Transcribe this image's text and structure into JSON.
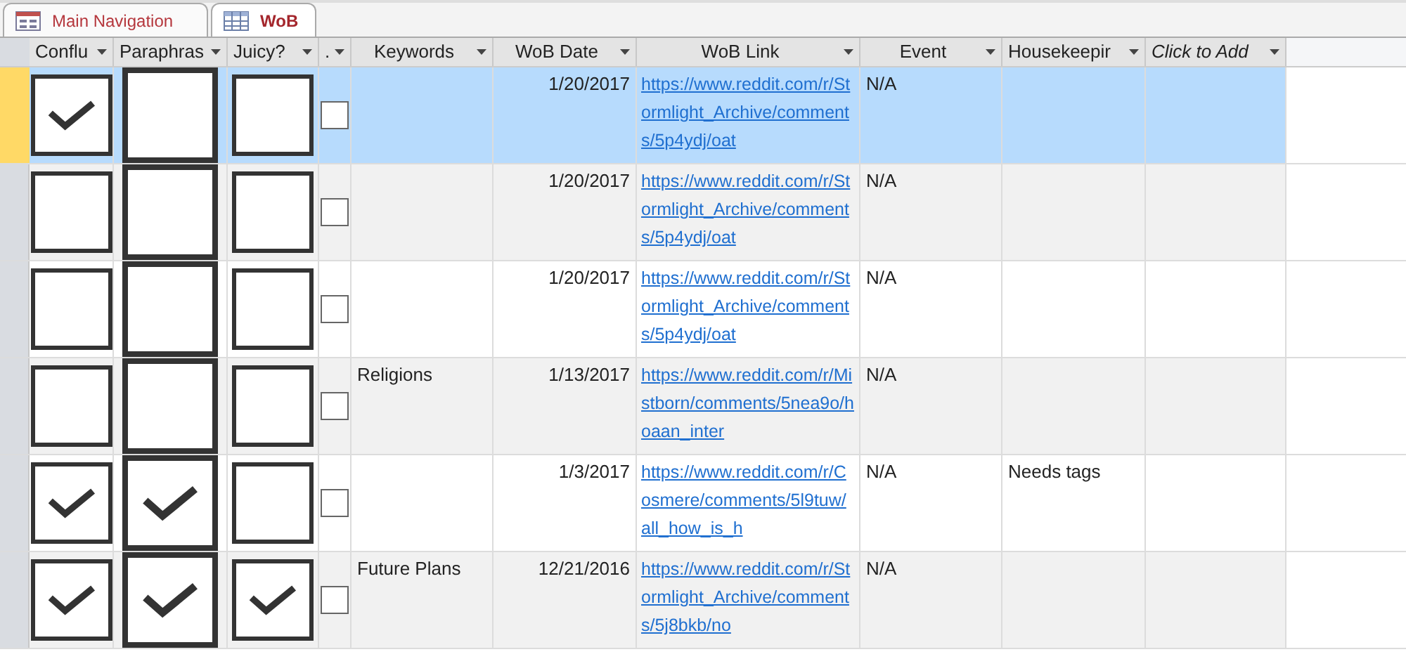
{
  "tabs": [
    {
      "label": "Main Navigation",
      "kind": "form",
      "selected": false
    },
    {
      "label": "WoB",
      "kind": "table",
      "selected": true
    }
  ],
  "table": {
    "columns": [
      {
        "label": "Conflu",
        "italic": false
      },
      {
        "label": "Paraphras",
        "italic": false
      },
      {
        "label": "Juicy?",
        "italic": false
      },
      {
        "label": ".",
        "italic": false
      },
      {
        "label": "Keywords",
        "italic": false
      },
      {
        "label": "WoB Date",
        "italic": false
      },
      {
        "label": "WoB Link",
        "italic": false
      },
      {
        "label": "Event",
        "italic": false
      },
      {
        "label": "Housekeepir",
        "italic": false
      },
      {
        "label": "Click to Add",
        "italic": true
      }
    ],
    "rows": [
      {
        "selected": true,
        "conflu": true,
        "paraphrase": false,
        "juicy": false,
        "column_4": false,
        "keywords": "",
        "date": "1/20/2017",
        "link": "https://www.reddit.com/r/Stormlight_Archive/comments/5p4ydj/oat",
        "event": "N/A",
        "housekeeping": ""
      },
      {
        "selected": false,
        "conflu": false,
        "paraphrase": false,
        "juicy": false,
        "column_4": false,
        "keywords": "",
        "date": "1/20/2017",
        "link": "https://www.reddit.com/r/Stormlight_Archive/comments/5p4ydj/oat",
        "event": "N/A",
        "housekeeping": ""
      },
      {
        "selected": false,
        "conflu": false,
        "paraphrase": false,
        "juicy": false,
        "column_4": false,
        "keywords": "",
        "date": "1/20/2017",
        "link": "https://www.reddit.com/r/Stormlight_Archive/comments/5p4ydj/oat",
        "event": "N/A",
        "housekeeping": ""
      },
      {
        "selected": false,
        "conflu": false,
        "paraphrase": false,
        "juicy": false,
        "column_4": false,
        "keywords": "Religions",
        "date": "1/13/2017",
        "link": "https://www.reddit.com/r/Mistborn/comments/5nea9o/hoaan_inter",
        "event": "N/A",
        "housekeeping": ""
      },
      {
        "selected": false,
        "conflu": true,
        "paraphrase": true,
        "juicy": false,
        "column_4": false,
        "keywords": "",
        "date": "1/3/2017",
        "link": "https://www.reddit.com/r/Cosmere/comments/5l9tuw/all_how_is_h",
        "event": "N/A",
        "housekeeping": "Needs tags"
      },
      {
        "selected": false,
        "conflu": true,
        "paraphrase": true,
        "juicy": true,
        "column_4": false,
        "keywords": "Future Plans",
        "date": "12/21/2016",
        "link": "https://www.reddit.com/r/Stormlight_Archive/comments/5j8bkb/no",
        "event": "N/A",
        "housekeeping": ""
      }
    ]
  }
}
